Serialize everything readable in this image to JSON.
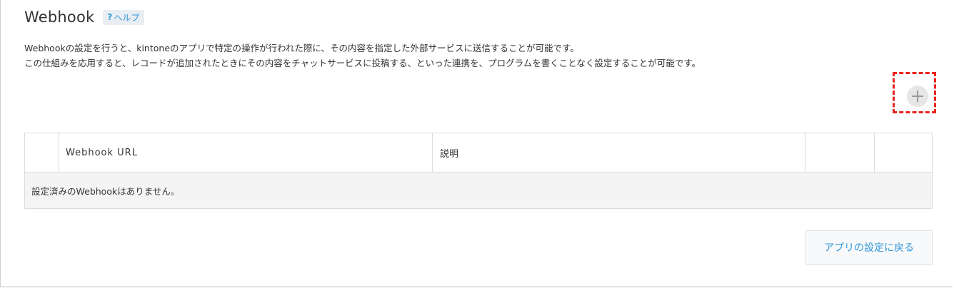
{
  "header": {
    "title": "Webhook",
    "help_icon": "?",
    "help_label": "ヘルプ"
  },
  "description": {
    "line1": "Webhookの設定を行うと、kintoneのアプリで特定の操作が行われた際に、その内容を指定した外部サービスに送信することが可能です。",
    "line2": "この仕組みを応用すると、レコードが追加されたときにその内容をチャットサービスに投稿する、といった連携を、プログラムを書くことなく設定することが可能です。"
  },
  "add_button": {
    "icon": "plus-icon",
    "highlight_color": "#e8231c"
  },
  "table": {
    "columns": [
      "",
      "Webhook URL",
      "説明",
      "",
      ""
    ],
    "empty_message": "設定済みのWebhookはありません。"
  },
  "footer": {
    "back_label": "アプリの設定に戻る"
  },
  "colors": {
    "link": "#3498db",
    "text": "#333333",
    "row_bg": "#f4f4f4"
  }
}
